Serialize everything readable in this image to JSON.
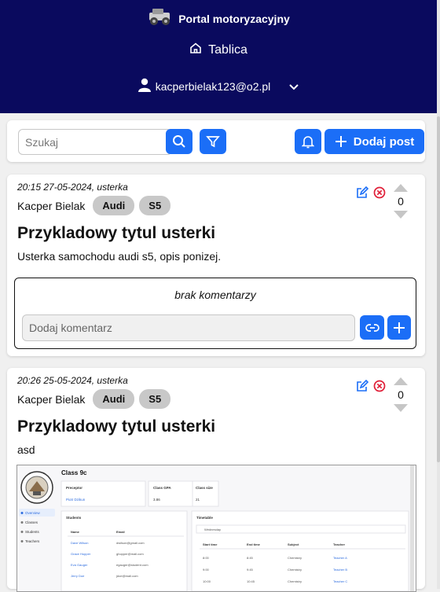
{
  "app": {
    "title": "Portal motoryzacyjny",
    "nav_home": "Tablica",
    "user_email": "kacperbielak123@o2.pl"
  },
  "toolbar": {
    "search_placeholder": "Szukaj",
    "add_post_label": "Dodaj post"
  },
  "posts": [
    {
      "meta": "20:15 27-05-2024, usterka",
      "author": "Kacper Bielak",
      "tags": [
        "Audi",
        "S5"
      ],
      "title": "Przykladowy tytul usterki",
      "body": "Usterka samochodu audi s5, opis ponizej.",
      "votes": "0",
      "no_comments": "brak komentarzy",
      "comment_placeholder": "Dodaj komentarz"
    },
    {
      "meta": "20:26 25-05-2024, usterka",
      "author": "Kacper Bielak",
      "tags": [
        "Audi",
        "S5"
      ],
      "title": "Przykladowy tytul usterki",
      "body": "asd",
      "votes": "0",
      "attachment": {
        "heading": "Class 9c",
        "stats": [
          {
            "label": "Preceptor",
            "value": "Piotr Dzikun"
          },
          {
            "label": "Class GPA",
            "value": "3.86"
          },
          {
            "label": "Class size",
            "value": "21"
          }
        ],
        "sidebar": [
          "Overview",
          "Classes",
          "Students",
          "Teachers"
        ],
        "students_title": "Students",
        "students_cols": [
          "Name",
          "Email"
        ],
        "students": [
          [
            "Dave Wilson",
            "dwilson@gmail.com"
          ],
          [
            "Grace Hopper",
            "ghopper@mail.com"
          ],
          [
            "Eva Gauger",
            "egauger@student.com"
          ],
          [
            "Jerry Doe",
            "jdoe@mail.com"
          ]
        ],
        "timetable_title": "Timetable",
        "timetable_day": "Wednesday",
        "timetable_cols": [
          "Start time",
          "End time",
          "Subject",
          "Teacher"
        ],
        "timetable": [
          [
            "8:00",
            "8:45",
            "Chemistry",
            "Teacher A"
          ],
          [
            "9:00",
            "9:45",
            "Chemistry",
            "Teacher B"
          ],
          [
            "10:00",
            "10:45",
            "Chemistry",
            "Teacher C"
          ]
        ]
      }
    }
  ]
}
